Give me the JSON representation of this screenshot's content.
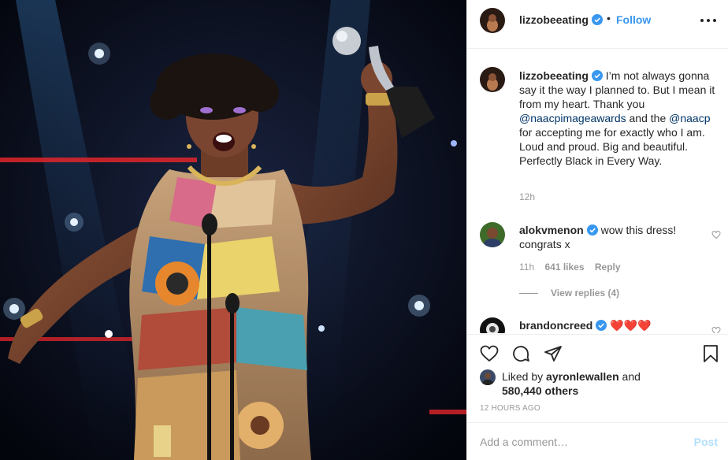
{
  "post": {
    "username": "lizzobeeating",
    "verified": true,
    "follow_label": "Follow",
    "separator": "•",
    "photo_alt": "photo"
  },
  "caption": {
    "username": "lizzobeeating",
    "text_before": "I’m not always gonna say it the way I planned to. But I mean it from my heart. Thank you ",
    "mention1": "@naacpimageawards",
    "text_middle": " and the ",
    "mention2": "@naacp",
    "text_after": " for accepting me for exactly who I am. Loud and proud. Big and beautiful. Perfectly Black in Every Way.",
    "time": "12h"
  },
  "comments": [
    {
      "username": "alokvmenon",
      "verified": true,
      "text": "wow this dress! congrats x",
      "time": "11h",
      "likes": "641 likes",
      "reply_label": "Reply",
      "view_replies": "View replies (4)"
    },
    {
      "username": "brandoncreed",
      "verified": true,
      "text": "❤️❤️❤️"
    }
  ],
  "likes": {
    "prefix": "Liked by ",
    "user": "ayronlewallen",
    "middle": " and",
    "count": "580,440 others"
  },
  "timestamp": "12 HOURS AGO",
  "comment_box": {
    "placeholder": "Add a comment…",
    "post_label": "Post"
  },
  "colors": {
    "accent": "#3897f0",
    "mention": "#003569",
    "muted": "#999999",
    "post_disabled": "#b2dffc",
    "verified_badge": "#3897f0",
    "heart_red": "#ed4956"
  },
  "icons": {
    "like": "heart-outline-icon",
    "comment": "comment-bubble-icon",
    "share": "paper-plane-icon",
    "save": "bookmark-icon",
    "more": "more-dots-icon",
    "verified": "verified-badge-icon"
  }
}
